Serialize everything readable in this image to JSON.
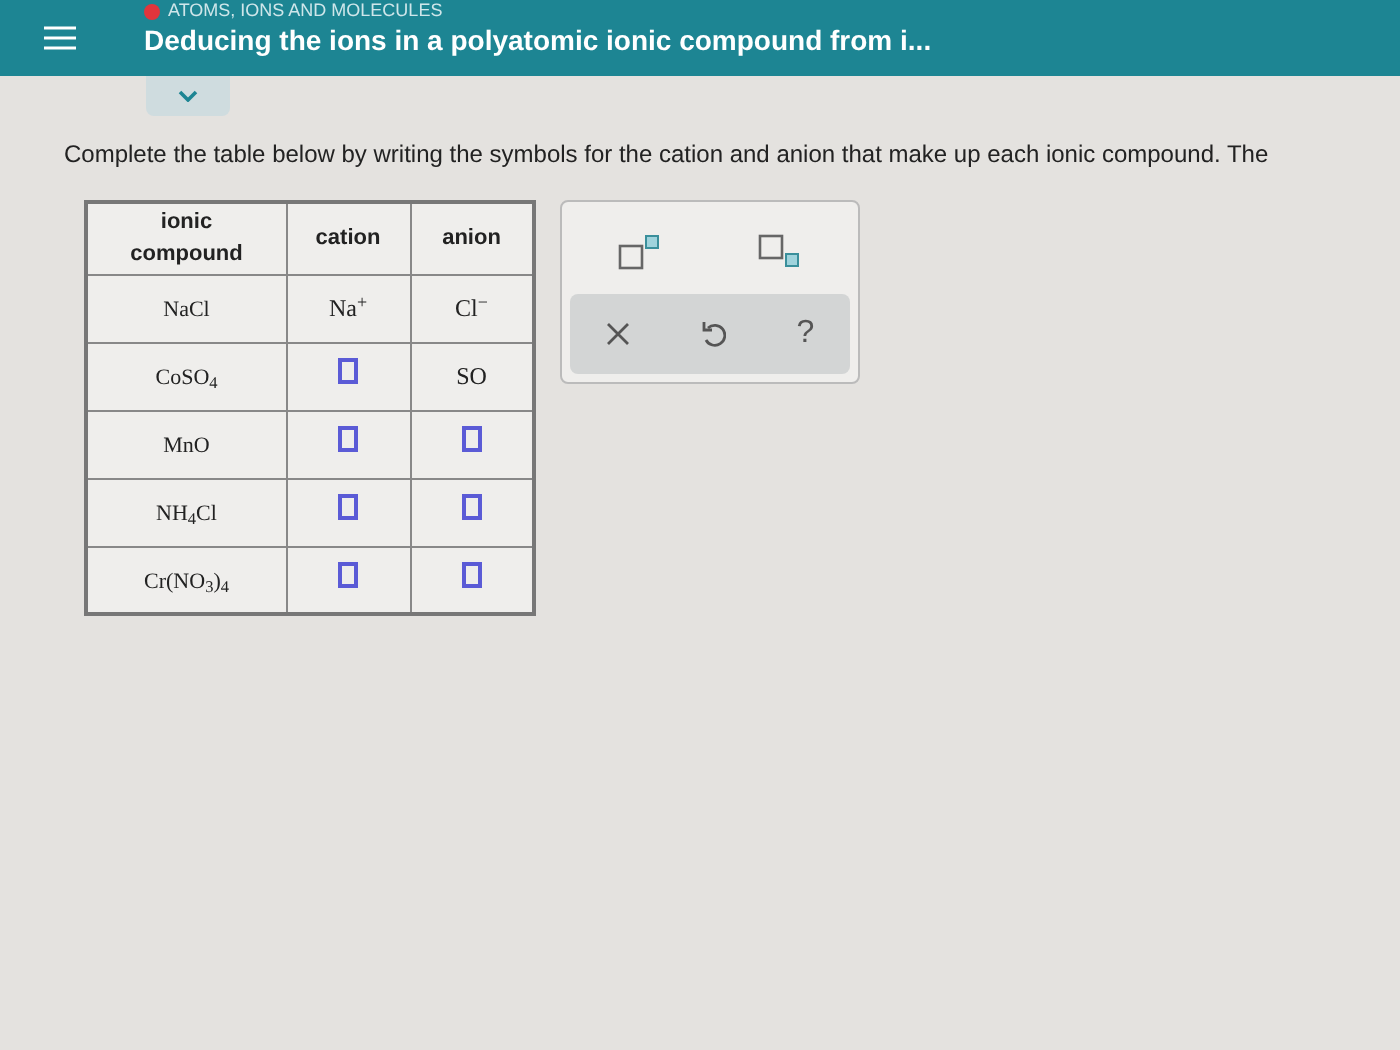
{
  "header": {
    "topic": "ATOMS, IONS AND MOLECULES",
    "title": "Deducing the ions in a polyatomic ionic compound from i..."
  },
  "instruction": "Complete the table below by writing the symbols for the cation and anion that make up each ionic compound. The",
  "table": {
    "columns": [
      "ionic compound",
      "cation",
      "anion"
    ],
    "rows": [
      {
        "compound": "NaCl",
        "cation": {
          "kind": "text",
          "text": "Na$^{+}$"
        },
        "anion": {
          "kind": "text",
          "text": "Cl$^{−}$"
        }
      },
      {
        "compound": "CoSO$_{4}$",
        "cation": {
          "kind": "box"
        },
        "anion": {
          "kind": "entry",
          "text": "SO"
        }
      },
      {
        "compound": "MnO",
        "cation": {
          "kind": "box"
        },
        "anion": {
          "kind": "box"
        }
      },
      {
        "compound": "NH$_{4}$Cl",
        "cation": {
          "kind": "box"
        },
        "anion": {
          "kind": "box"
        }
      },
      {
        "compound": "Cr(NO$_{3}$)$_{4}$",
        "cation": {
          "kind": "box"
        },
        "anion": {
          "kind": "box"
        }
      }
    ]
  },
  "toolbar": {
    "help": "?"
  }
}
